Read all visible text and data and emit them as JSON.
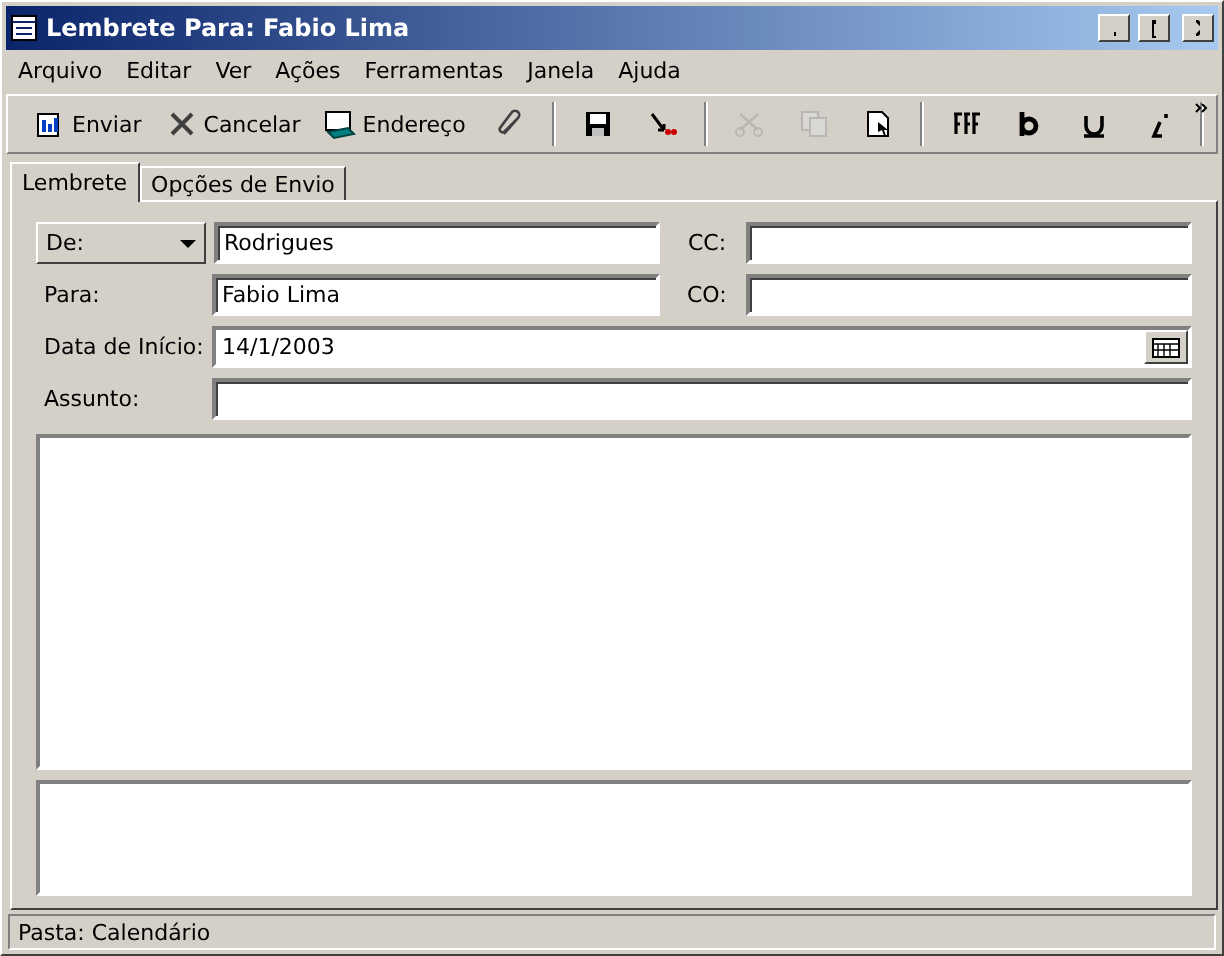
{
  "window": {
    "title": "Lembrete Para: Fabio Lima"
  },
  "menu": [
    "Arquivo",
    "Editar",
    "Ver",
    "Ações",
    "Ferramentas",
    "Janela",
    "Ajuda"
  ],
  "toolbar": [
    {
      "kind": "button",
      "label": "Enviar",
      "disabled": false
    },
    {
      "kind": "button",
      "label": "Cancelar",
      "disabled": false
    },
    {
      "kind": "button",
      "label": "Endereço",
      "disabled": false
    },
    {
      "kind": "icon",
      "disabled": false
    },
    {
      "kind": "separator"
    },
    {
      "kind": "icon",
      "disabled": false
    },
    {
      "kind": "icon",
      "disabled": false
    },
    {
      "kind": "separator"
    },
    {
      "kind": "icon",
      "disabled": true
    },
    {
      "kind": "icon",
      "disabled": true
    },
    {
      "kind": "icon",
      "disabled": false
    },
    {
      "kind": "separator"
    },
    {
      "kind": "icon",
      "disabled": false
    },
    {
      "kind": "icon",
      "disabled": false
    },
    {
      "kind": "icon",
      "disabled": false
    },
    {
      "kind": "icon",
      "disabled": false
    },
    {
      "kind": "separator"
    }
  ],
  "tabs": [
    {
      "label": "Lembrete",
      "selected": true
    },
    {
      "label": "Opções de Envio",
      "selected": false
    }
  ],
  "form": {
    "from": {
      "label": "De:",
      "value": "Rodrigues"
    },
    "cc": {
      "label": "CC:"
    },
    "to": {
      "label": "Para:",
      "value": "Fabio Lima"
    },
    "bcc": {
      "label": "CO:"
    },
    "start_date": {
      "label": "Data de Início:",
      "value": "14/1/2003"
    },
    "subject": {
      "label": "Assunto:"
    }
  },
  "status_bar": "Pasta: Calendário"
}
